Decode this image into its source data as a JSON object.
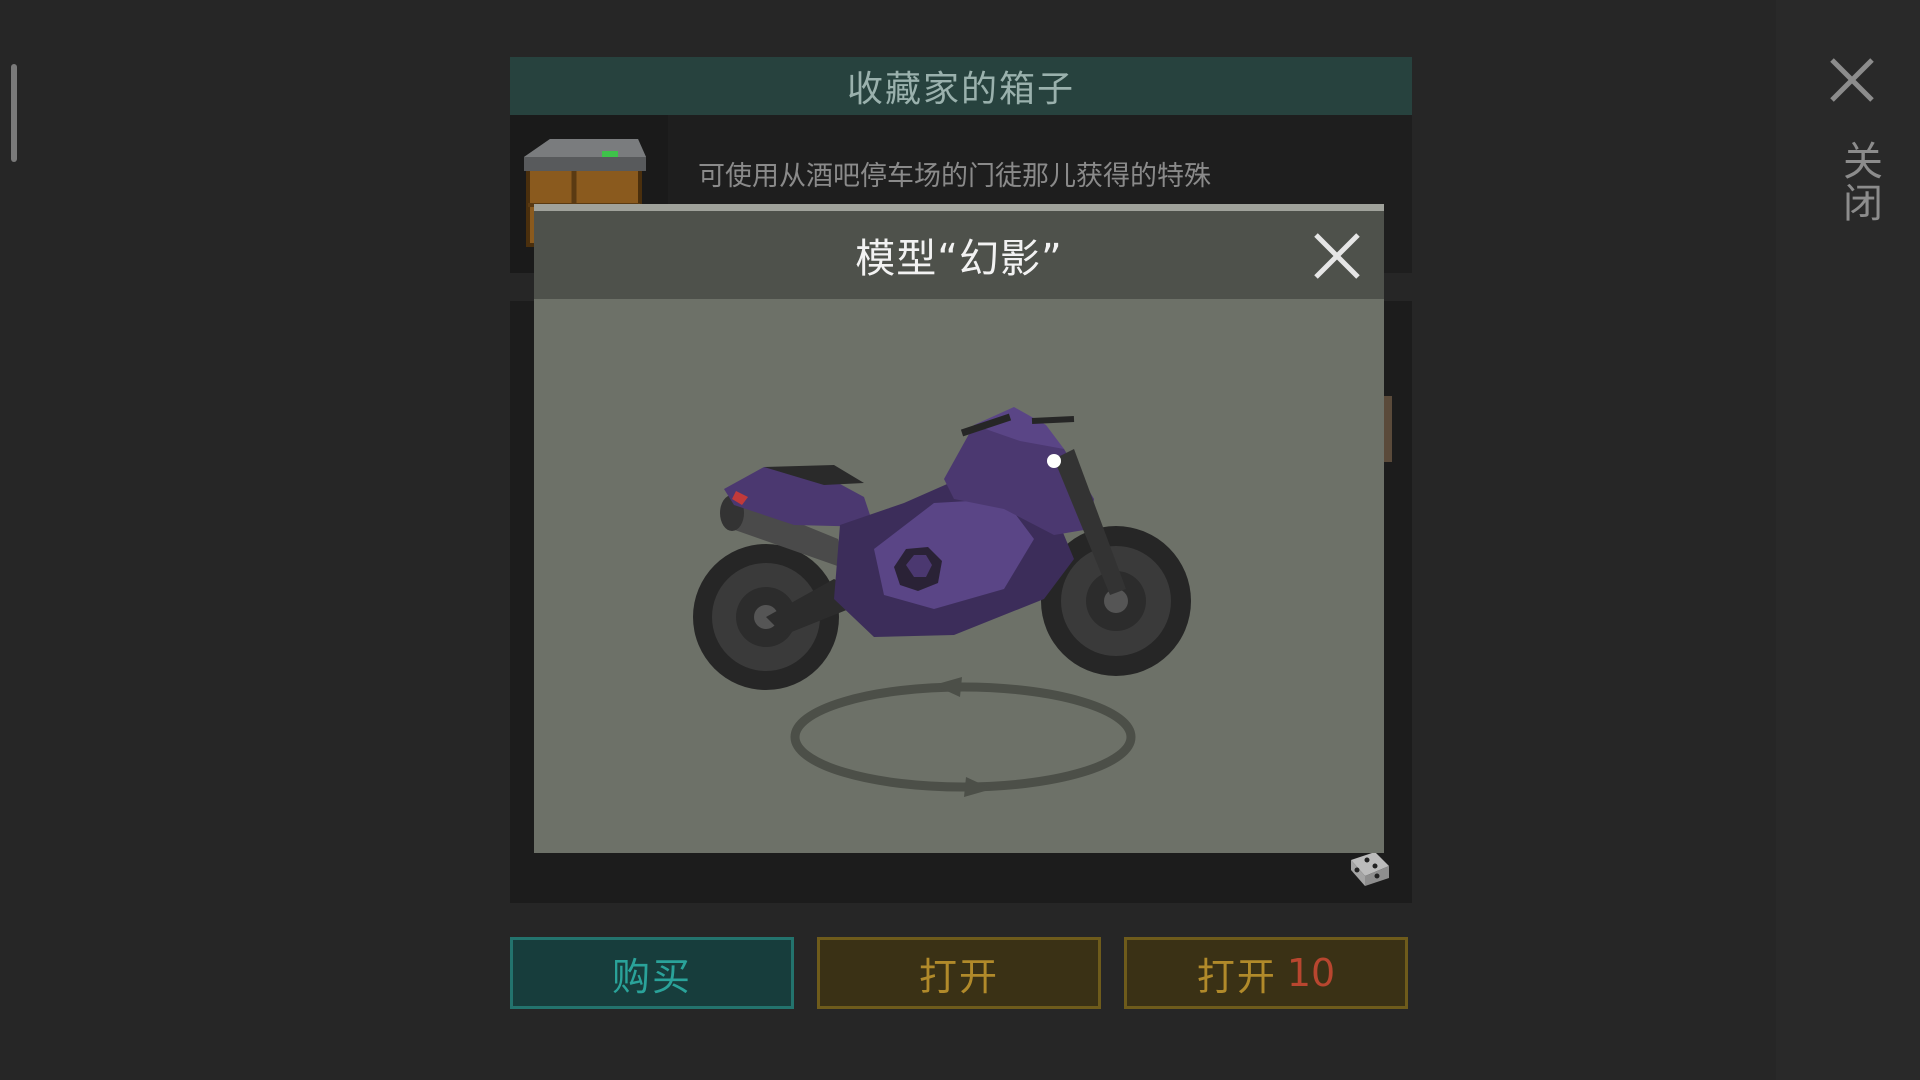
{
  "chest": {
    "title": "收藏家的箱子",
    "description": "可使用从酒吧停车场的门徒那儿获得的特殊"
  },
  "close": {
    "label": "关闭",
    "icon": "close-icon"
  },
  "modal": {
    "title": "模型“幻影”",
    "close_icon": "close-icon",
    "model_icon": "motorcycle-model",
    "rotate_icon": "rotate-icon"
  },
  "buttons": {
    "buy_label": "购买",
    "open_label": "打开",
    "open10_label": "打开",
    "open10_count": "10"
  },
  "colors": {
    "accent_teal": "#2aa39a",
    "accent_gold": "#b18a2a",
    "accent_red": "#b8462f",
    "model_purple": "#4b3870"
  }
}
